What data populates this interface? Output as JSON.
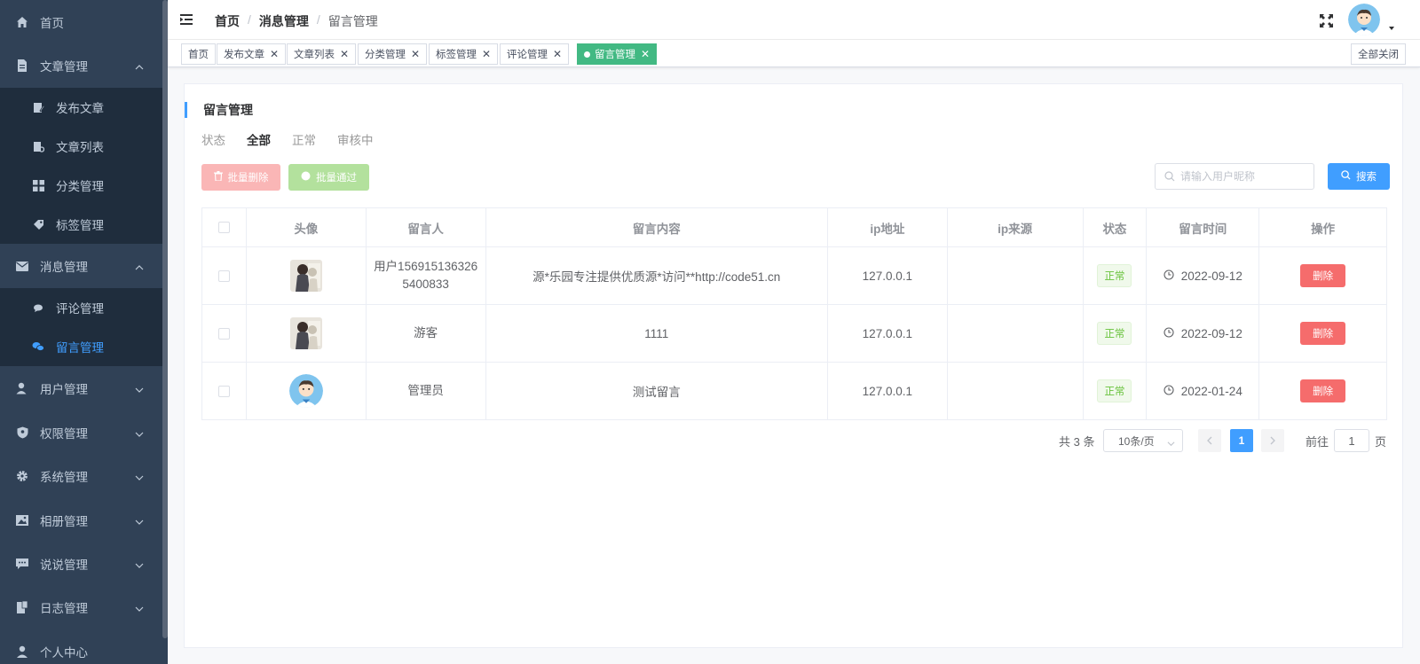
{
  "sidebar": {
    "items": [
      {
        "label": "首页",
        "icon": "home-icon"
      },
      {
        "label": "文章管理",
        "icon": "document-icon"
      },
      {
        "label": "发布文章",
        "icon": "edit-icon"
      },
      {
        "label": "文章列表",
        "icon": "list-icon"
      },
      {
        "label": "分类管理",
        "icon": "grid-icon"
      },
      {
        "label": "标签管理",
        "icon": "tag-icon"
      },
      {
        "label": "消息管理",
        "icon": "mail-icon"
      },
      {
        "label": "评论管理",
        "icon": "comment-icon"
      },
      {
        "label": "留言管理",
        "icon": "chat-icon"
      },
      {
        "label": "用户管理",
        "icon": "user-icon"
      },
      {
        "label": "权限管理",
        "icon": "shield-icon"
      },
      {
        "label": "系统管理",
        "icon": "gear-icon"
      },
      {
        "label": "相册管理",
        "icon": "picture-icon"
      },
      {
        "label": "说说管理",
        "icon": "message-icon"
      },
      {
        "label": "日志管理",
        "icon": "log-icon"
      },
      {
        "label": "个人中心",
        "icon": "person-icon"
      }
    ]
  },
  "header": {
    "breadcrumb": [
      "首页",
      "消息管理",
      "留言管理"
    ],
    "separator": "/"
  },
  "tags": {
    "items": [
      "首页",
      "发布文章",
      "文章列表",
      "分类管理",
      "标签管理",
      "评论管理",
      "留言管理"
    ],
    "close_symbol": "✕",
    "close_all": "全部关闭"
  },
  "page": {
    "title": "留言管理",
    "status_label": "状态",
    "status_options": [
      "全部",
      "正常",
      "审核中"
    ],
    "batch_delete": "批量删除",
    "batch_pass": "批量通过",
    "search_placeholder": "请输入用户昵称",
    "search_button": "搜索"
  },
  "table": {
    "columns": [
      "头像",
      "留言人",
      "留言内容",
      "ip地址",
      "ip来源",
      "状态",
      "留言时间",
      "操作"
    ],
    "rows": [
      {
        "name": "用户1569151363265400833",
        "content": "源*乐园专注提供优质源*访问**http://code51.cn",
        "ip": "127.0.0.1",
        "source": "",
        "status": "正常",
        "time": "2022-09-12",
        "action": "删除"
      },
      {
        "name": "游客",
        "content": "1111",
        "ip": "127.0.0.1",
        "source": "",
        "status": "正常",
        "time": "2022-09-12",
        "action": "删除"
      },
      {
        "name": "管理员",
        "content": "测试留言",
        "ip": "127.0.0.1",
        "source": "",
        "status": "正常",
        "time": "2022-01-24",
        "action": "删除"
      }
    ]
  },
  "pagination": {
    "total": "共 3 条",
    "page_size": "10条/页",
    "current_page": "1",
    "goto_label": "前往",
    "goto_value": "1",
    "page_suffix": "页"
  },
  "colors": {
    "sidebar_bg": "#304156",
    "primary": "#409eff",
    "success": "#42b983",
    "danger": "#f56c6c"
  }
}
